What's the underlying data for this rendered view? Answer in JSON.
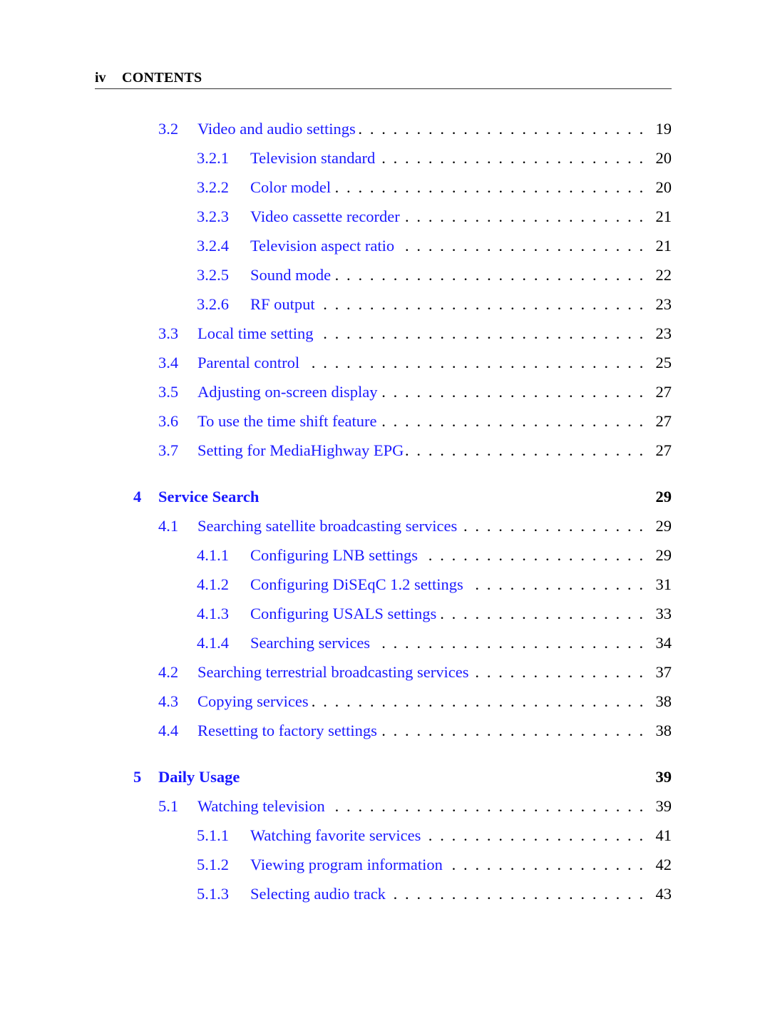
{
  "header": {
    "page_number": "iv",
    "title": "CONTENTS"
  },
  "colors": {
    "link": "#1a1aff",
    "text": "#000000"
  },
  "entries": [
    {
      "level": 1,
      "num": "3.2",
      "title": "Video and audio settings",
      "page": "19"
    },
    {
      "level": 2,
      "num": "3.2.1",
      "title": "Television standard",
      "page": "20"
    },
    {
      "level": 2,
      "num": "3.2.2",
      "title": "Color model",
      "page": "20"
    },
    {
      "level": 2,
      "num": "3.2.3",
      "title": "Video cassette recorder",
      "page": "21"
    },
    {
      "level": 2,
      "num": "3.2.4",
      "title": "Television aspect ratio",
      "page": "21"
    },
    {
      "level": 2,
      "num": "3.2.5",
      "title": "Sound mode",
      "page": "22"
    },
    {
      "level": 2,
      "num": "3.2.6",
      "title": "RF output",
      "page": "23"
    },
    {
      "level": 1,
      "num": "3.3",
      "title": "Local time setting",
      "page": "23"
    },
    {
      "level": 1,
      "num": "3.4",
      "title": "Parental control",
      "page": "25"
    },
    {
      "level": 1,
      "num": "3.5",
      "title": "Adjusting on-screen display",
      "page": "27"
    },
    {
      "level": 1,
      "num": "3.6",
      "title": "To use the time shift feature",
      "page": "27"
    },
    {
      "level": 1,
      "num": "3.7",
      "title": "Setting for MediaHighway EPG",
      "page": "27"
    },
    {
      "level": 0,
      "num": "4",
      "title": "Service Search",
      "page": "29"
    },
    {
      "level": 1,
      "num": "4.1",
      "title": "Searching satellite broadcasting services",
      "page": "29"
    },
    {
      "level": 2,
      "num": "4.1.1",
      "title": "Configuring LNB settings",
      "page": "29"
    },
    {
      "level": 2,
      "num": "4.1.2",
      "title": "Configuring DiSEqC 1.2 settings",
      "page": "31"
    },
    {
      "level": 2,
      "num": "4.1.3",
      "title": "Configuring USALS settings",
      "page": "33"
    },
    {
      "level": 2,
      "num": "4.1.4",
      "title": "Searching services",
      "page": "34"
    },
    {
      "level": 1,
      "num": "4.2",
      "title": "Searching terrestrial broadcasting services",
      "page": "37"
    },
    {
      "level": 1,
      "num": "4.3",
      "title": "Copying services",
      "page": "38"
    },
    {
      "level": 1,
      "num": "4.4",
      "title": "Resetting to factory settings",
      "page": "38"
    },
    {
      "level": 0,
      "num": "5",
      "title": "Daily Usage",
      "page": "39"
    },
    {
      "level": 1,
      "num": "5.1",
      "title": "Watching television",
      "page": "39"
    },
    {
      "level": 2,
      "num": "5.1.1",
      "title": "Watching favorite services",
      "page": "41"
    },
    {
      "level": 2,
      "num": "5.1.2",
      "title": "Viewing program information",
      "page": "42"
    },
    {
      "level": 2,
      "num": "5.1.3",
      "title": "Selecting audio track",
      "page": "43"
    }
  ]
}
